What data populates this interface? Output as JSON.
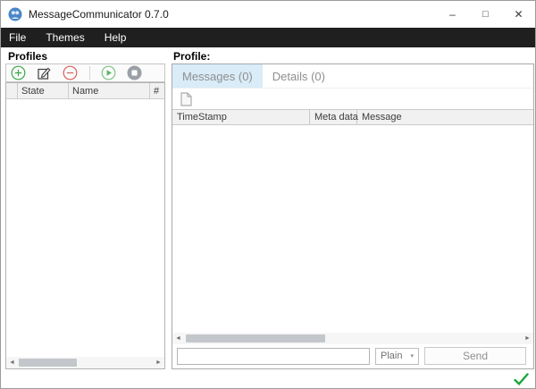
{
  "window": {
    "title": "MessageCommunicator 0.7.0",
    "controls": {
      "minimize": "–",
      "maximize": "□",
      "close": "✕"
    }
  },
  "menu": {
    "items": [
      "File",
      "Themes",
      "Help"
    ]
  },
  "profiles_panel": {
    "title": "Profiles",
    "toolbar": {
      "add": "add-profile",
      "edit": "edit-profile",
      "remove": "remove-profile",
      "start": "start-profile",
      "stop": "stop-profile"
    },
    "table": {
      "columns": [
        "",
        "State",
        "Name",
        "#"
      ],
      "rows": []
    },
    "scrollbar": {
      "left_arrow": "◄",
      "right_arrow": "►"
    }
  },
  "profile_panel": {
    "title": "Profile:",
    "tabs": [
      {
        "label": "Messages (0)",
        "active": true
      },
      {
        "label": "Details (0)",
        "active": false
      }
    ],
    "toolbar": {
      "new_document": "new-document"
    },
    "message_table": {
      "columns": [
        "TimeStamp",
        "Meta data",
        "Message"
      ],
      "rows": []
    },
    "scrollbar": {
      "left_arrow": "◄",
      "right_arrow": "►"
    },
    "composer": {
      "message_value": "",
      "format_selected": "Plain",
      "format_arrow": "▾",
      "send_label": "Send"
    }
  },
  "statusbar": {
    "status": "ok",
    "status_icon": "check-icon"
  },
  "colors": {
    "menu_bg": "#1f1f1f",
    "tab_active_bg": "#d9ecf8",
    "accent_green": "#3aa74a",
    "accent_red": "#e05c5c",
    "toolbar_gray": "#9aa0a6",
    "status_green": "#1ca53c"
  }
}
